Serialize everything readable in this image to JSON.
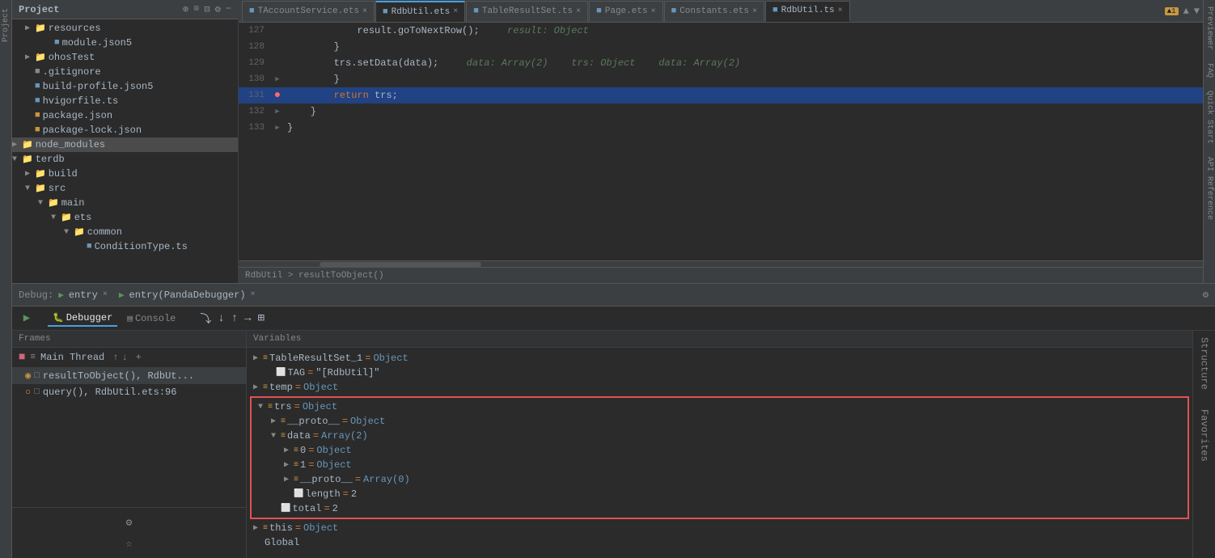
{
  "leftSidebar": {
    "label": "Project"
  },
  "projectTree": {
    "title": "Project",
    "items": [
      {
        "id": "resources",
        "indent": 1,
        "arrow": "▶",
        "type": "folder",
        "label": "resources",
        "color": "gray"
      },
      {
        "id": "module-json5",
        "indent": 3,
        "arrow": "",
        "type": "file",
        "label": "module.json5",
        "color": "blue"
      },
      {
        "id": "ohostest",
        "indent": 1,
        "arrow": "▶",
        "type": "folder",
        "label": "ohosTest",
        "color": "gray"
      },
      {
        "id": "gitignore",
        "indent": 1,
        "arrow": "",
        "type": "file",
        "label": ".gitignore",
        "color": "gray"
      },
      {
        "id": "build-profile",
        "indent": 1,
        "arrow": "",
        "type": "file",
        "label": "build-profile.json5",
        "color": "blue"
      },
      {
        "id": "hvigorfile",
        "indent": 1,
        "arrow": "",
        "type": "file",
        "label": "hvigorfile.ts",
        "color": "blue"
      },
      {
        "id": "package-json",
        "indent": 1,
        "arrow": "",
        "type": "file",
        "label": "package.json",
        "color": "orange"
      },
      {
        "id": "package-lock",
        "indent": 1,
        "arrow": "",
        "type": "file",
        "label": "package-lock.json",
        "color": "orange"
      },
      {
        "id": "node-modules",
        "indent": 0,
        "arrow": "▶",
        "type": "folder",
        "label": "node_modules",
        "color": "orange",
        "highlighted": true
      },
      {
        "id": "terdb",
        "indent": 0,
        "arrow": "▼",
        "type": "folder",
        "label": "terdb",
        "color": "orange"
      },
      {
        "id": "build",
        "indent": 1,
        "arrow": "▶",
        "type": "folder",
        "label": "build",
        "color": "orange"
      },
      {
        "id": "src",
        "indent": 1,
        "arrow": "▼",
        "type": "folder",
        "label": "src",
        "color": "gray"
      },
      {
        "id": "main",
        "indent": 2,
        "arrow": "▼",
        "type": "folder",
        "label": "main",
        "color": "gray"
      },
      {
        "id": "ets",
        "indent": 3,
        "arrow": "▼",
        "type": "folder",
        "label": "ets",
        "color": "gray"
      },
      {
        "id": "common",
        "indent": 4,
        "arrow": "▼",
        "type": "folder",
        "label": "common",
        "color": "gray"
      },
      {
        "id": "conditiontype",
        "indent": 5,
        "arrow": "",
        "type": "file",
        "label": "ConditionType.ts",
        "color": "blue"
      }
    ]
  },
  "editorTabs": [
    {
      "id": "taccountservice",
      "label": "TAccountService.ets",
      "active": false,
      "color": "#6897bb"
    },
    {
      "id": "rdbutil-ets",
      "label": "RdbUtil.ets",
      "active": false,
      "color": "#6897bb"
    },
    {
      "id": "tableresultset",
      "label": "TableResultSet.ts",
      "active": false,
      "color": "#6897bb"
    },
    {
      "id": "page-ets",
      "label": "Page.ets",
      "active": false,
      "color": "#6897bb"
    },
    {
      "id": "constants",
      "label": "Constants.ets",
      "active": false,
      "color": "#6897bb"
    },
    {
      "id": "rdbutil-ts",
      "label": "RdbUtil.ts",
      "active": true,
      "color": "#6897bb"
    }
  ],
  "codeLines": [
    {
      "num": 127,
      "content": "            result.goToNextRow();  ",
      "hint": "result: Object",
      "gutter": "",
      "highlighted": false,
      "breakpoint": false
    },
    {
      "num": 128,
      "content": "        }",
      "hint": "",
      "gutter": "",
      "highlighted": false,
      "breakpoint": false
    },
    {
      "num": 129,
      "content": "        trs.setData(data);  ",
      "hint": "data: Array(2)    trs: Object    data: Array(2)",
      "gutter": "",
      "highlighted": false,
      "breakpoint": false
    },
    {
      "num": 130,
      "content": "        }",
      "hint": "",
      "gutter": "▶",
      "highlighted": false,
      "breakpoint": false
    },
    {
      "num": 131,
      "content": "        return trs;",
      "hint": "",
      "gutter": "●",
      "highlighted": true,
      "breakpoint": true
    },
    {
      "num": 132,
      "content": "    }",
      "hint": "",
      "gutter": "▶",
      "highlighted": false,
      "breakpoint": false
    },
    {
      "num": 133,
      "content": "}",
      "hint": "",
      "gutter": "▶",
      "highlighted": false,
      "breakpoint": false
    }
  ],
  "editorFooter": {
    "breadcrumb": "RdbUtil > resultToObject()"
  },
  "warningBadge": "▲1",
  "debugHeader": {
    "label": "Debug:",
    "entry1": "entry",
    "entry2": "entry(PandaDebugger)"
  },
  "debugTabs": [
    {
      "id": "debugger",
      "label": "Debugger",
      "active": true
    },
    {
      "id": "console",
      "label": "Console",
      "active": false
    }
  ],
  "framesPanel": {
    "header": "Frames",
    "threadLabel": "Main Thread",
    "frames": [
      {
        "id": "frame1",
        "label": "resultToObject(), RdbUt...",
        "icon": "□"
      },
      {
        "id": "frame2",
        "label": "query(), RdbUtil.ets:96",
        "icon": "□"
      }
    ]
  },
  "variablesPanel": {
    "header": "Variables",
    "items": [
      {
        "id": "tableresultset",
        "indent": 0,
        "arrow": "▶",
        "icon": "≡",
        "name": "TableResultSet_1",
        "eq": "=",
        "type": "Object",
        "highlighted": false
      },
      {
        "id": "tag",
        "indent": 1,
        "arrow": "",
        "icon": "⬜",
        "name": "TAG",
        "eq": "=",
        "val": "\"[RdbUtil]\"",
        "highlighted": false
      },
      {
        "id": "temp",
        "indent": 0,
        "arrow": "▶",
        "icon": "≡",
        "name": "temp",
        "eq": "=",
        "type": "Object",
        "highlighted": false
      },
      {
        "id": "trs",
        "indent": 0,
        "arrow": "▼",
        "icon": "≡",
        "name": "trs",
        "eq": "=",
        "type": "Object",
        "highlighted": true,
        "boxStart": true
      },
      {
        "id": "proto1",
        "indent": 2,
        "arrow": "▶",
        "icon": "≡",
        "name": "__proto__",
        "eq": "=",
        "type": "Object",
        "highlighted": true
      },
      {
        "id": "data-arr",
        "indent": 2,
        "arrow": "▼",
        "icon": "≡",
        "name": "data",
        "eq": "=",
        "type": "Array(2)",
        "highlighted": true
      },
      {
        "id": "data0",
        "indent": 3,
        "arrow": "▶",
        "icon": "≡",
        "name": "0",
        "eq": "=",
        "type": "Object",
        "highlighted": true
      },
      {
        "id": "data1",
        "indent": 3,
        "arrow": "▶",
        "icon": "≡",
        "name": "1",
        "eq": "=",
        "type": "Object",
        "highlighted": true
      },
      {
        "id": "proto2",
        "indent": 3,
        "arrow": "▶",
        "icon": "≡",
        "name": "__proto__",
        "eq": "=",
        "type": "Array(0)",
        "highlighted": true
      },
      {
        "id": "length",
        "indent": 3,
        "arrow": "",
        "icon": "⬜",
        "name": "length",
        "eq": "=",
        "val": "2",
        "highlighted": true
      },
      {
        "id": "total",
        "indent": 2,
        "arrow": "",
        "icon": "⬜",
        "name": "total",
        "eq": "=",
        "val": "2",
        "highlighted": true,
        "boxEnd": true
      },
      {
        "id": "this",
        "indent": 0,
        "arrow": "▶",
        "icon": "≡",
        "name": "this",
        "eq": "=",
        "type": "Object",
        "highlighted": false
      },
      {
        "id": "global",
        "indent": 0,
        "arrow": "",
        "icon": "",
        "name": "Global",
        "eq": "",
        "type": "",
        "highlighted": false
      }
    ]
  },
  "rightSidebarItems": [
    {
      "id": "previewer",
      "label": "Previewer"
    },
    {
      "id": "faq",
      "label": "FAQ"
    },
    {
      "id": "quick-start",
      "label": "Quick Start"
    },
    {
      "id": "api-reference",
      "label": "API Reference"
    }
  ]
}
